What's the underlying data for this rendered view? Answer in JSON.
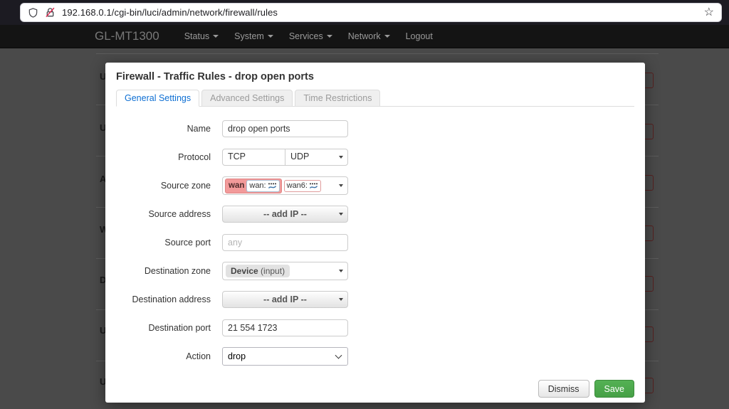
{
  "browser": {
    "url": "192.168.0.1/cgi-bin/luci/admin/network/firewall/rules",
    "star_icon": "☆"
  },
  "navbar": {
    "brand": "GL-MT1300",
    "items": [
      {
        "label": "Status",
        "caret": true
      },
      {
        "label": "System",
        "caret": true
      },
      {
        "label": "Services",
        "caret": true
      },
      {
        "label": "Network",
        "caret": true
      },
      {
        "label": "Logout",
        "caret": false
      }
    ]
  },
  "background": {
    "row_letters": [
      "U",
      "U",
      "A",
      "W",
      "D",
      "U",
      "U"
    ]
  },
  "modal": {
    "title": "Firewall - Traffic Rules - drop open ports",
    "tabs": [
      {
        "label": "General Settings",
        "active": true
      },
      {
        "label": "Advanced Settings",
        "active": false
      },
      {
        "label": "Time Restrictions",
        "active": false
      }
    ],
    "fields": {
      "name": {
        "label": "Name",
        "value": "drop open ports"
      },
      "protocol": {
        "label": "Protocol",
        "selected": [
          "TCP",
          "UDP"
        ]
      },
      "source_zone": {
        "label": "Source zone",
        "zone": "wan",
        "networks": [
          "wan:",
          "wan6:"
        ]
      },
      "source_address": {
        "label": "Source address",
        "value": "-- add IP --"
      },
      "source_port": {
        "label": "Source port",
        "placeholder": "any"
      },
      "destination_zone": {
        "label": "Destination zone",
        "zone": "Device",
        "zone_suffix": "(input)"
      },
      "destination_address": {
        "label": "Destination address",
        "value": "-- add IP --"
      },
      "destination_port": {
        "label": "Destination port",
        "value": "21 554 1723"
      },
      "action": {
        "label": "Action",
        "value": "drop"
      }
    },
    "buttons": {
      "dismiss": "Dismiss",
      "save": "Save"
    }
  },
  "colors": {
    "accent_blue": "#0e6fd3",
    "save_green": "#4cae4c",
    "zone_wan_pink": "#f29a9a",
    "danger_red": "#b94a48",
    "overlay_gray": "#4a4a4a"
  }
}
